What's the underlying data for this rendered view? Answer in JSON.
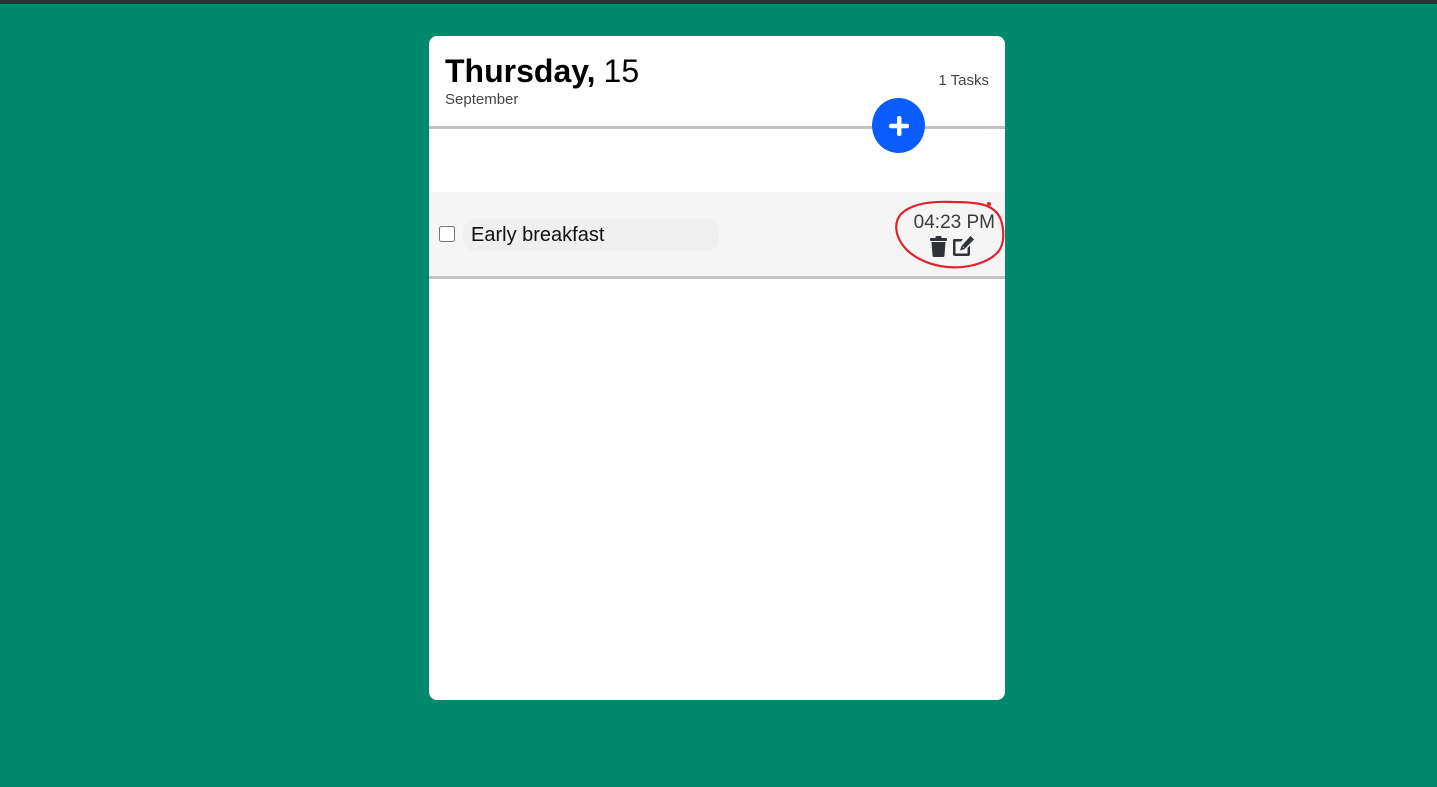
{
  "header": {
    "day_name": "Thursday,",
    "day_number": "15",
    "month": "September",
    "task_count": "1 Tasks"
  },
  "add_button": {
    "icon": "plus-icon",
    "color": "#0a5cff"
  },
  "tasks": [
    {
      "text": "Early breakfast",
      "checked": false,
      "time": "04:23 PM",
      "actions": [
        "trash-icon",
        "edit-icon"
      ]
    }
  ],
  "colors": {
    "background": "#00896a",
    "card": "#ffffff",
    "task_row": "#f5f5f5",
    "annotation": "#e0232b"
  }
}
